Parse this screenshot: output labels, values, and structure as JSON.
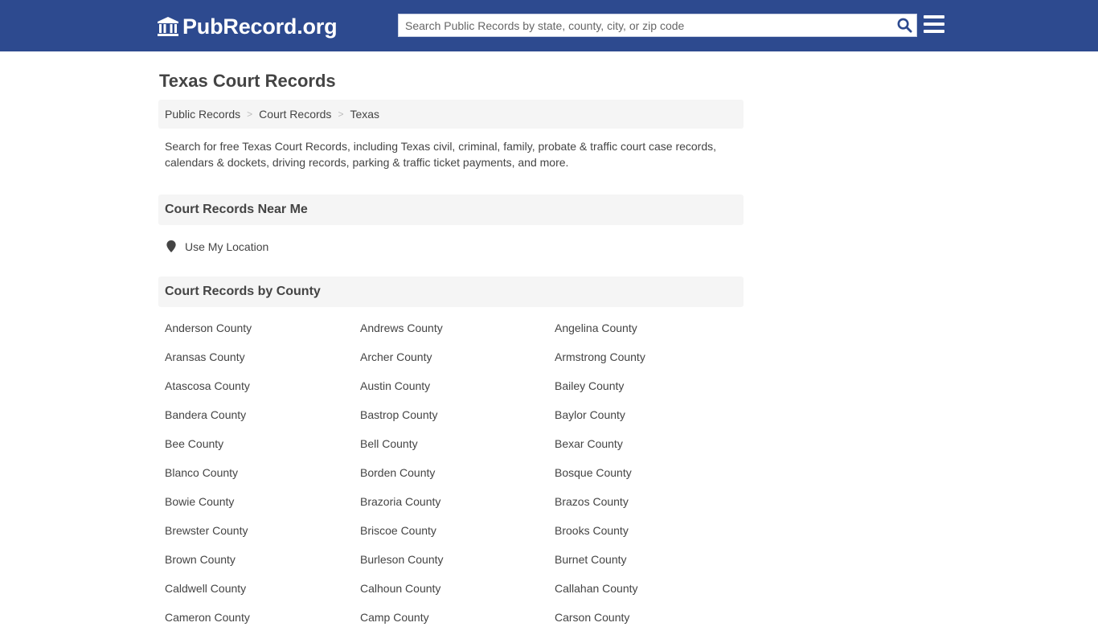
{
  "header": {
    "logo_text": "PubRecord.org",
    "search_placeholder": "Search Public Records by state, county, city, or zip code",
    "colors": {
      "bar": "#2d4a8f",
      "search_icon": "#2d4a8f"
    },
    "icons": {
      "logo": "courthouse-icon",
      "search": "search-icon",
      "menu": "hamburger-menu-icon"
    }
  },
  "page": {
    "title": "Texas Court Records",
    "breadcrumb": [
      "Public Records",
      "Court Records",
      "Texas"
    ],
    "breadcrumb_separator": ">",
    "intro": "Search for free Texas Court Records, including Texas civil, criminal, family, probate & traffic court case records, calendars & dockets, driving records, parking & traffic ticket payments, and more."
  },
  "near_me": {
    "heading": "Court Records Near Me",
    "location_label": "Use My Location",
    "icon": "map-marker-icon"
  },
  "by_county": {
    "heading": "Court Records by County",
    "counties": [
      "Anderson County",
      "Andrews County",
      "Angelina County",
      "Aransas County",
      "Archer County",
      "Armstrong County",
      "Atascosa County",
      "Austin County",
      "Bailey County",
      "Bandera County",
      "Bastrop County",
      "Baylor County",
      "Bee County",
      "Bell County",
      "Bexar County",
      "Blanco County",
      "Borden County",
      "Bosque County",
      "Bowie County",
      "Brazoria County",
      "Brazos County",
      "Brewster County",
      "Briscoe County",
      "Brooks County",
      "Brown County",
      "Burleson County",
      "Burnet County",
      "Caldwell County",
      "Calhoun County",
      "Callahan County",
      "Cameron County",
      "Camp County",
      "Carson County"
    ]
  }
}
